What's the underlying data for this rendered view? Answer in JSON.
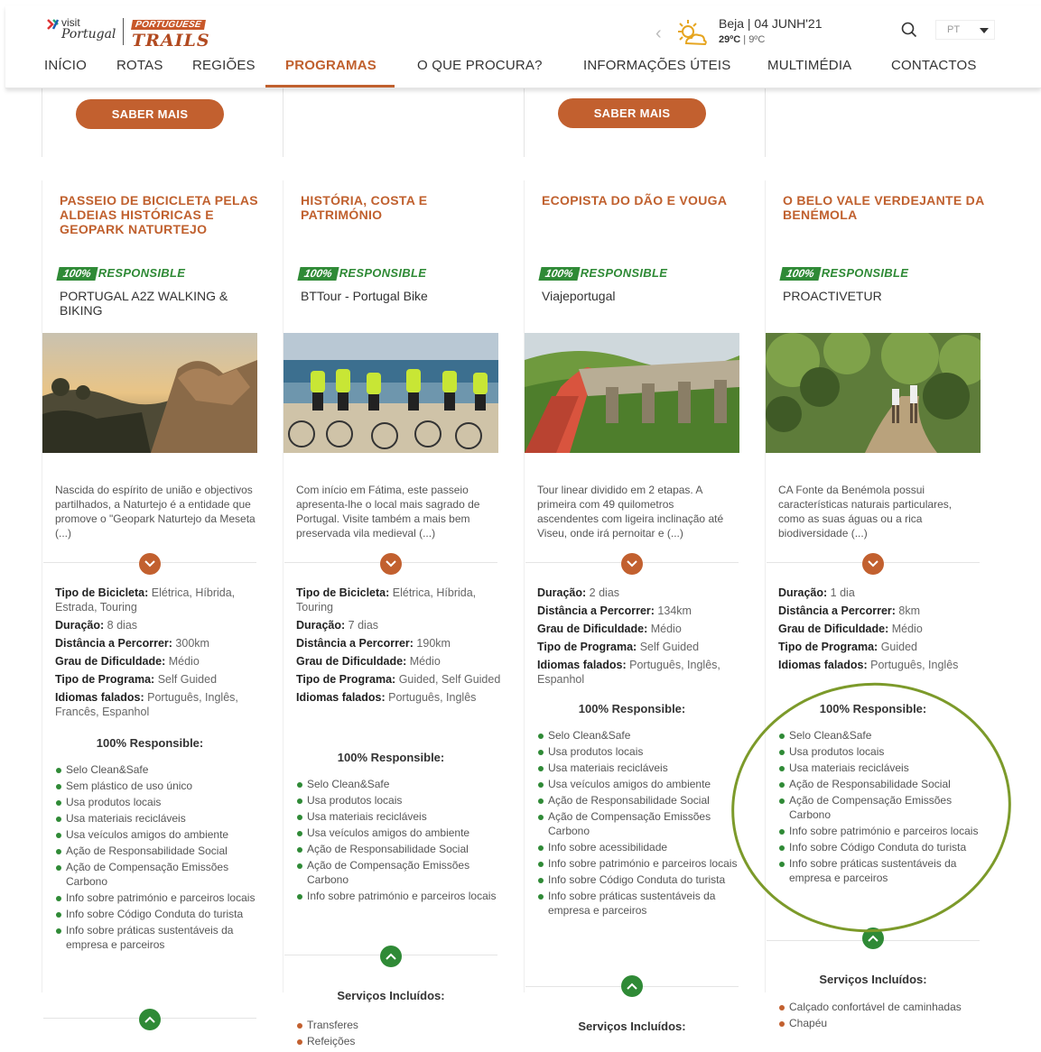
{
  "header": {
    "logo_visit": {
      "line1": "visit",
      "line2": "Portugal"
    },
    "logo_trails": {
      "line1": "PORTUGUESE",
      "line2": "TRAILS"
    },
    "weather": {
      "location": "Beja | 04 JUNH'21",
      "high": "29ºC",
      "separator": "|",
      "low": "9ºC"
    },
    "language": "PT",
    "nav": [
      {
        "label": "INÍCIO"
      },
      {
        "label": "ROTAS"
      },
      {
        "label": "REGIÕES"
      },
      {
        "label": "PROGRAMAS"
      },
      {
        "label": "O QUE PROCURA?"
      },
      {
        "label": "INFORMAÇÕES ÚTEIS"
      },
      {
        "label": "MULTIMÉDIA"
      },
      {
        "label": "CONTACTOS"
      }
    ],
    "active_nav": "PROGRAMAS"
  },
  "badge": {
    "pct": "100%",
    "label": "RESPONSIBLE"
  },
  "saber_mais": "SABER MAIS",
  "cards": [
    {
      "title": "PASSEIO DE BICICLETA PELAS ALDEIAS HISTÓRICAS E GEOPARK NATURTEJO",
      "operator": "PORTUGAL A2Z WALKING & BIKING",
      "description": "Nascida do espírito de união e objectivos partilhados, a Naturtejo é a entidade que promove o \"Geopark Naturtejo da Meseta (...)",
      "specs": [
        {
          "k": "Tipo de Bicicleta:",
          "v": "Elétrica, Híbrida, Estrada, Touring"
        },
        {
          "k": "Duração:",
          "v": "8 dias"
        },
        {
          "k": "Distância a Percorrer:",
          "v": "300km"
        },
        {
          "k": "Grau de Dificuldade:",
          "v": "Médio"
        },
        {
          "k": "Tipo de Programa:",
          "v": "Self Guided"
        },
        {
          "k": "Idiomas falados:",
          "v": "Português, Inglês, Francês, Espanhol"
        }
      ],
      "resp_title": "100% Responsible:",
      "features": [
        "Selo Clean&Safe",
        "Sem plástico de uso único",
        "Usa produtos locais",
        "Usa materiais recicláveis",
        "Usa veículos amigos do ambiente",
        "Ação de Responsabilidade Social",
        "Ação de Compensação Emissões Carbono",
        "Info sobre património e parceiros locais",
        "Info sobre Código Conduta do turista",
        "Info sobre práticas sustentáveis da empresa e parceiros"
      ]
    },
    {
      "title": "HISTÓRIA, COSTA E PATRIMÓNIO",
      "operator": "BTTour - Portugal Bike",
      "description": "Com início em Fátima, este passeio apresenta-lhe o local mais sagrado de Portugal. Visite também a mais bem preservada vila medieval (...)",
      "specs": [
        {
          "k": "Tipo de Bicicleta:",
          "v": "Elétrica, Híbrida, Touring"
        },
        {
          "k": "Duração:",
          "v": "7 dias"
        },
        {
          "k": "Distância a Percorrer:",
          "v": "190km"
        },
        {
          "k": "Grau de Dificuldade:",
          "v": "Médio"
        },
        {
          "k": "Tipo de Programa:",
          "v": "Guided, Self Guided"
        },
        {
          "k": "Idiomas falados:",
          "v": "Português, Inglês"
        }
      ],
      "resp_title": "100% Responsible:",
      "features": [
        "Selo Clean&Safe",
        "Usa produtos locais",
        "Usa materiais recicláveis",
        "Usa veículos amigos do ambiente",
        "Ação de Responsabilidade Social",
        "Ação de Compensação Emissões Carbono",
        "Info sobre património e parceiros locais"
      ],
      "serv_title": "Serviços Incluídos:",
      "services": [
        "Transferes",
        "Refeições"
      ]
    },
    {
      "title": "ECOPISTA DO DÃO E VOUGA",
      "operator": "Viajeportugal",
      "description": "Tour linear dividido em 2 etapas. A primeira com 49 quilometros ascendentes com ligeira inclinação até Viseu, onde irá pernoitar e (...)",
      "specs": [
        {
          "k": "Duração:",
          "v": "2 dias"
        },
        {
          "k": "Distância a Percorrer:",
          "v": "134km"
        },
        {
          "k": "Grau de Dificuldade:",
          "v": "Médio"
        },
        {
          "k": "Tipo de Programa:",
          "v": "Self Guided"
        },
        {
          "k": "Idiomas falados:",
          "v": "Português, Inglês, Espanhol"
        }
      ],
      "resp_title": "100% Responsible:",
      "features": [
        "Selo Clean&Safe",
        "Usa produtos locais",
        "Usa materiais recicláveis",
        "Usa veículos amigos do ambiente",
        "Ação de Responsabilidade Social",
        "Ação de Compensação Emissões Carbono",
        "Info sobre acessibilidade",
        "Info sobre património e parceiros locais",
        "Info sobre Código Conduta do turista",
        "Info sobre práticas sustentáveis da empresa e parceiros"
      ],
      "serv_title": "Serviços Incluídos:"
    },
    {
      "title": "O BELO VALE VERDEJANTE DA BENÉMOLA",
      "operator": "PROACTIVETUR",
      "description": "CA Fonte da Benémola possui características naturais particulares, como as suas águas ou a rica biodiversidade (...)",
      "specs": [
        {
          "k": "Duração:",
          "v": "1 dia"
        },
        {
          "k": "Distância a Percorrer:",
          "v": "8km"
        },
        {
          "k": "Grau de Dificuldade:",
          "v": "Médio"
        },
        {
          "k": "Tipo de Programa:",
          "v": "Guided"
        },
        {
          "k": "Idiomas falados:",
          "v": "Português, Inglês"
        }
      ],
      "resp_title": "100% Responsible:",
      "features": [
        "Selo Clean&Safe",
        "Usa produtos locais",
        "Usa materiais recicláveis",
        "Ação de Responsabilidade Social",
        "Ação de Compensação Emissões Carbono",
        "Info sobre património e parceiros locais",
        "Info sobre Código Conduta do turista",
        "Info sobre práticas sustentáveis da empresa e parceiros"
      ],
      "serv_title": "Serviços Incluídos:",
      "services": [
        "Calçado confortável de caminhadas",
        "Chapéu"
      ]
    }
  ],
  "colors": {
    "accent": "#c0602e",
    "green": "#2f8a36",
    "highlight": "#7c9a2a"
  }
}
